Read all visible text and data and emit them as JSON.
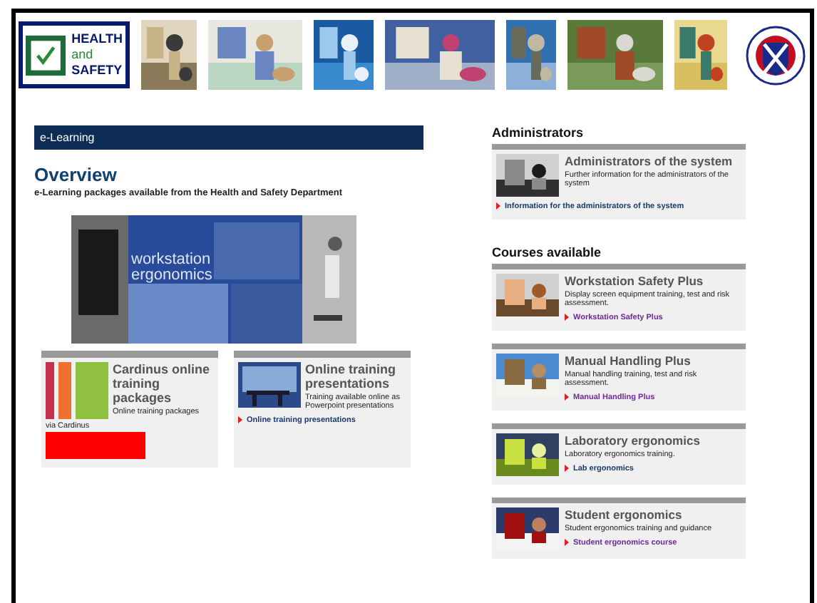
{
  "banner": {
    "logo": {
      "line1": "HEALTH",
      "line2": "and",
      "line3": "SAFETY"
    }
  },
  "main": {
    "section_bar": "e-Learning",
    "title": "Overview",
    "subtitle": "e-Learning packages available from the Health and Safety Department",
    "hero_image": {
      "caption_line1": "workstation",
      "caption_line2": "ergonomics"
    },
    "cards": [
      {
        "kind": "stripes",
        "title": "Cardinus online training packages",
        "text": "Online training packages",
        "extra": "via Cardinus"
      },
      {
        "title": "Online training presentations",
        "text": "Training available online as Powerpoint presentations",
        "link": {
          "label": "Online training presentations",
          "visited": false
        }
      }
    ]
  },
  "sidebar": {
    "sections": [
      {
        "heading": "Administrators",
        "items": [
          {
            "title": "Administrators of the system",
            "text": "Further information for the administrators of the system",
            "link": {
              "label": "Information for the administrators of the system",
              "visited": false
            }
          }
        ]
      },
      {
        "heading": "Courses available",
        "items": [
          {
            "title": "Workstation Safety Plus",
            "text": "Display screen equipment training, test and risk assessment.",
            "link": {
              "label": "Workstation Safety Plus",
              "visited": true
            }
          },
          {
            "title": "Manual Handling Plus",
            "text": "Manual handling training, test and risk assessment.",
            "link": {
              "label": "Manual Handling Plus",
              "visited": true
            }
          },
          {
            "title": "Laboratory ergonomics",
            "text": "Laboratory ergonomics training.",
            "link": {
              "label": "Lab ergonomics",
              "visited": false
            }
          },
          {
            "title": "Student ergonomics",
            "text": "Student ergonomics training and guidance",
            "link": {
              "label": "Student ergonomics course",
              "visited": true
            }
          }
        ]
      }
    ]
  }
}
